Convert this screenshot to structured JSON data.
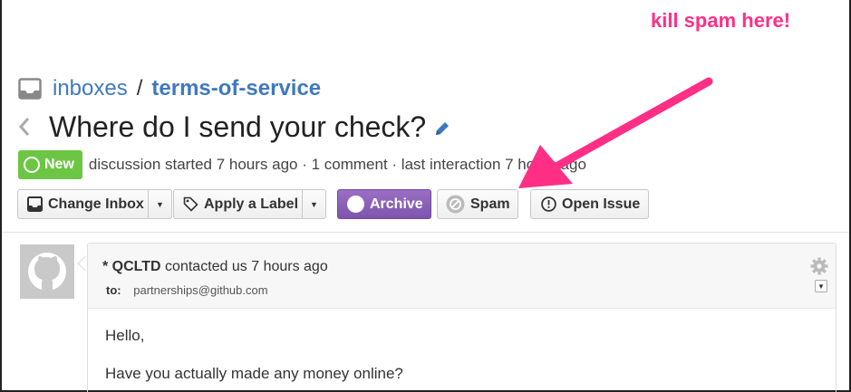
{
  "annotation": {
    "text": "kill spam here!",
    "color": "#ff2f86"
  },
  "breadcrumb": {
    "parent": "inboxes",
    "separator": "/",
    "current": "terms-of-service"
  },
  "issue": {
    "title": "Where do I send your check?"
  },
  "meta": {
    "badge": "New",
    "summary": "discussion started 7 hours ago · 1 comment · last interaction 7 hours ago"
  },
  "toolbar": {
    "change_inbox": "Change Inbox",
    "apply_label": "Apply a Label",
    "archive": "Archive",
    "spam": "Spam",
    "open_issue": "Open Issue"
  },
  "comment": {
    "author": "* QCLTD",
    "action": "contacted us 7 hours ago",
    "to_label": "to:",
    "to_address": "partnerships@github.com",
    "body": [
      "Hello,",
      "Have you actually made any money online?"
    ]
  },
  "colors": {
    "brand_link": "#4078c0",
    "new_badge": "#6cc644",
    "archive": "#8a60b8"
  }
}
